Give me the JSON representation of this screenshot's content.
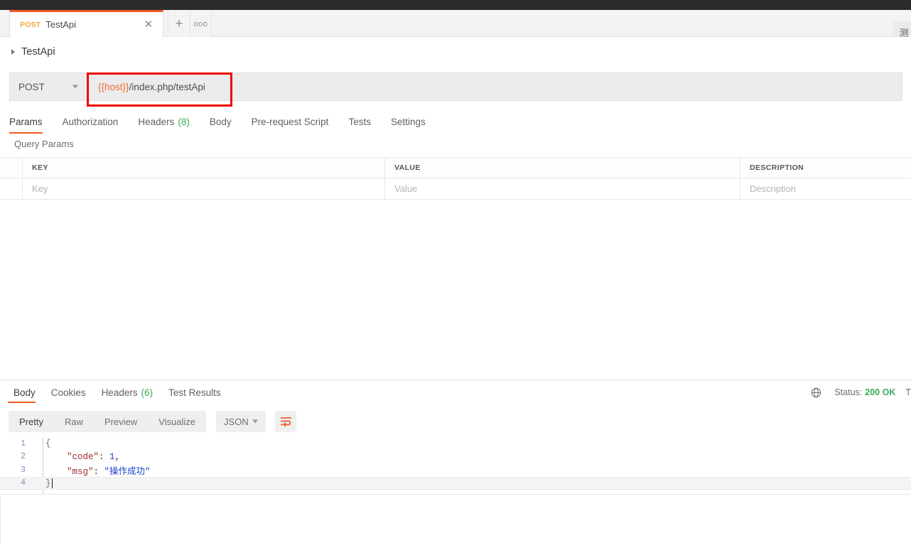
{
  "window": {
    "corner_button_label": "测"
  },
  "tabbar": {
    "active_tab": {
      "method": "POST",
      "title": "TestApi",
      "close_icon": "close-icon"
    },
    "new_tab_label": "+",
    "more_label": "ooo"
  },
  "breadcrumb": {
    "arrow_icon": "chevron-right-icon",
    "label": "TestApi"
  },
  "request": {
    "method": "POST",
    "url_prefix": "{{host}}",
    "url_suffix": "/index.php/testApi",
    "url_full": "{{host}}/index.php/testApi",
    "tabs": [
      {
        "label": "Params",
        "active": true
      },
      {
        "label": "Authorization",
        "active": false
      },
      {
        "label": "Headers",
        "count": "(8)",
        "active": false
      },
      {
        "label": "Body",
        "active": false
      },
      {
        "label": "Pre-request Script",
        "active": false
      },
      {
        "label": "Tests",
        "active": false
      },
      {
        "label": "Settings",
        "active": false
      }
    ]
  },
  "query_params": {
    "section_label": "Query Params",
    "columns": [
      "KEY",
      "VALUE",
      "DESCRIPTION"
    ],
    "rows": [
      {
        "key_placeholder": "Key",
        "value_placeholder": "Value",
        "description_placeholder": "Description"
      }
    ]
  },
  "response": {
    "tabs": [
      {
        "label": "Body",
        "active": true
      },
      {
        "label": "Cookies",
        "active": false
      },
      {
        "label": "Headers",
        "count": "(6)",
        "active": false
      },
      {
        "label": "Test Results",
        "active": false
      }
    ],
    "status_icon": "globe-icon",
    "status_label": "Status:",
    "status_value": "200 OK",
    "time_label": "T",
    "format_tabs": [
      {
        "label": "Pretty",
        "active": true
      },
      {
        "label": "Raw",
        "active": false
      },
      {
        "label": "Preview",
        "active": false
      },
      {
        "label": "Visualize",
        "active": false
      }
    ],
    "format_select": "JSON",
    "wrap_icon": "word-wrap-icon",
    "body_lines": [
      {
        "num": "1",
        "open_brace": "{"
      },
      {
        "num": "2",
        "key": "\"code\"",
        "sep": ": ",
        "num_value": "1",
        "comma": ","
      },
      {
        "num": "3",
        "key": "\"msg\"",
        "sep": ": ",
        "str_value": "\"操作成功\""
      },
      {
        "num": "4",
        "close_brace": "}"
      }
    ]
  },
  "colors": {
    "accent": "#ef5b25",
    "method_post": "#f2a83b",
    "count_green": "#3bab5a",
    "annotation_red": "#ee0000",
    "variable_orange": "#ef6c34"
  }
}
